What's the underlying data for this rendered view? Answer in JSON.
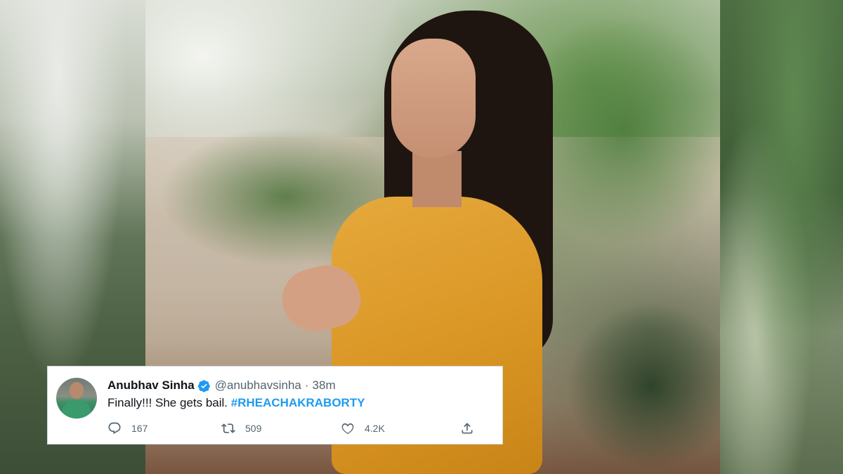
{
  "tweet": {
    "display_name": "Anubhav Sinha",
    "handle": "@anubhavsinha",
    "separator": "·",
    "time": "38m",
    "text": "Finally!!! She gets bail.",
    "hashtag": "#RHEACHAKRABORTY",
    "verified": true,
    "actions": {
      "reply_count": "167",
      "retweet_count": "509",
      "like_count": "4.2K"
    }
  },
  "icons": {
    "verified": "verified-badge-icon",
    "reply": "reply-icon",
    "retweet": "retweet-icon",
    "like": "heart-icon",
    "share": "share-icon"
  },
  "colors": {
    "accent": "#1d9bf0",
    "text": "#0f1419",
    "muted": "#536471"
  }
}
